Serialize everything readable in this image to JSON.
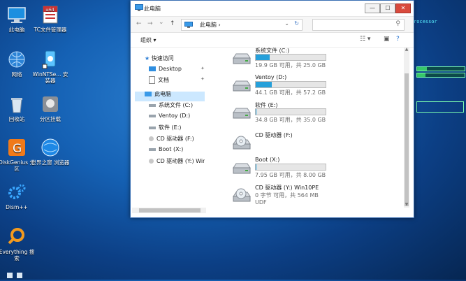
{
  "desktop": {
    "icons": [
      {
        "label": "此电脑",
        "name": "this-pc-icon"
      },
      {
        "label": "TC文件管理器",
        "name": "total-commander-icon"
      },
      {
        "label": "网络",
        "name": "network-icon"
      },
      {
        "label": "WinNTSe... 安装器",
        "name": "winntsetup-icon"
      },
      {
        "label": "回收站",
        "name": "recycle-bin-icon"
      },
      {
        "label": "分区挂载",
        "name": "partition-mount-icon"
      },
      {
        "label": "DiskGenius 分区",
        "name": "diskgenius-icon"
      },
      {
        "label": "世界之窗 浏览器",
        "name": "world-browser-icon"
      },
      {
        "label": "Dism++",
        "name": "dism-icon"
      },
      {
        "label": "Everything 搜索",
        "name": "everything-icon"
      }
    ],
    "bg_text": "rocessor"
  },
  "window": {
    "title": "此电脑",
    "btn_min": "—",
    "btn_max": "☐",
    "btn_close": "✕",
    "address": {
      "crumb": "此电脑",
      "sep": "›",
      "dropdown": "⌄",
      "refresh": "↻"
    },
    "search": {
      "placeholder": "",
      "icon": "⚲"
    },
    "nav": {
      "back": "←",
      "forward": "→",
      "recent": "⌄",
      "up": "↑"
    },
    "toolbar": {
      "organize": "组织 ▾",
      "view": "☷ ▾",
      "pane": "▣",
      "help": "?"
    }
  },
  "navpane": {
    "items": [
      {
        "label": "快速访问",
        "pinned": false
      },
      {
        "label": "Desktop",
        "pinned": true
      },
      {
        "label": "文档",
        "pinned": true
      },
      {
        "label": "此电脑",
        "pinned": false,
        "selected": true
      },
      {
        "label": "系统文件 (C:)",
        "pinned": false
      },
      {
        "label": "Ventoy (D:)",
        "pinned": false
      },
      {
        "label": "软件 (E:)",
        "pinned": false
      },
      {
        "label": "CD 驱动器 (F:)",
        "pinned": false
      },
      {
        "label": "Boot (X:)",
        "pinned": false
      },
      {
        "label": "CD 驱动器 (Y:) Win",
        "pinned": false
      }
    ],
    "pin_glyph": "📌"
  },
  "drives": [
    {
      "name": "系统文件 (C:)",
      "info": "19.9 GB 可用，共 25.0 GB",
      "used_fraction": 0.2,
      "type": "hdd"
    },
    {
      "name": "Ventoy (D:)",
      "info": "44.1 GB 可用，共 57.2 GB",
      "used_fraction": 0.23,
      "type": "hdd"
    },
    {
      "name": "软件 (E:)",
      "info": "34.8 GB 可用，共 35.0 GB",
      "used_fraction": 0.01,
      "type": "hdd"
    },
    {
      "name": "CD 驱动器 (F:)",
      "info": "",
      "used_fraction": null,
      "type": "cd"
    },
    {
      "name": "Boot (X:)",
      "info": "7.95 GB 可用，共 8.00 GB",
      "used_fraction": 0.01,
      "type": "hdd"
    },
    {
      "name": "CD 驱动器 (Y:) Win10PE",
      "info": "0 字节 可用，共 564 MB",
      "info2": "UDF",
      "used_fraction": 1.0,
      "type": "cd"
    }
  ],
  "colors": {
    "accent": "#26a0da",
    "selection": "#cce8ff",
    "close": "#d94a3d"
  }
}
